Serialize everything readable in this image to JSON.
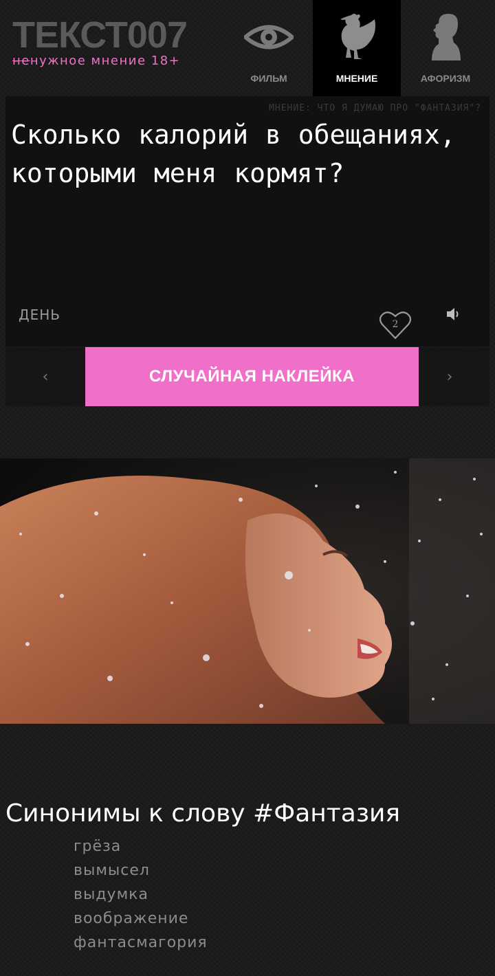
{
  "header": {
    "logo_title": "ТЕКСТ007",
    "logo_sub_strike": "не",
    "logo_sub_rest": "нужное мнение 18+",
    "nav": [
      {
        "label": "ФИЛЬМ",
        "icon": "eye-icon"
      },
      {
        "label": "МНЕНИЕ",
        "icon": "chicken-icon"
      },
      {
        "label": "АФОРИЗМ",
        "icon": "profile-head-icon"
      }
    ]
  },
  "card": {
    "subtitle": "МНЕНИЕ: ЧТО Я ДУМАЮ ПРО \"ФАНТАЗИЯ\"?",
    "quote": "Сколько калорий в обещаниях, которыми меня кормят?",
    "day_label": "ДЕНЬ",
    "likes": "2"
  },
  "strip": {
    "prev": "‹",
    "next": "›",
    "random_label": "СЛУЧАЙНАЯ НАКЛЕЙКА"
  },
  "synonyms": {
    "title": "Синонимы к слову #Фантазия",
    "items": [
      "грёза",
      "вымысел",
      "выдумка",
      "воображение",
      "фантасмагория"
    ]
  },
  "colors": {
    "accent": "#f06fc9",
    "background": "#1b1b1b",
    "card": "#111111"
  }
}
